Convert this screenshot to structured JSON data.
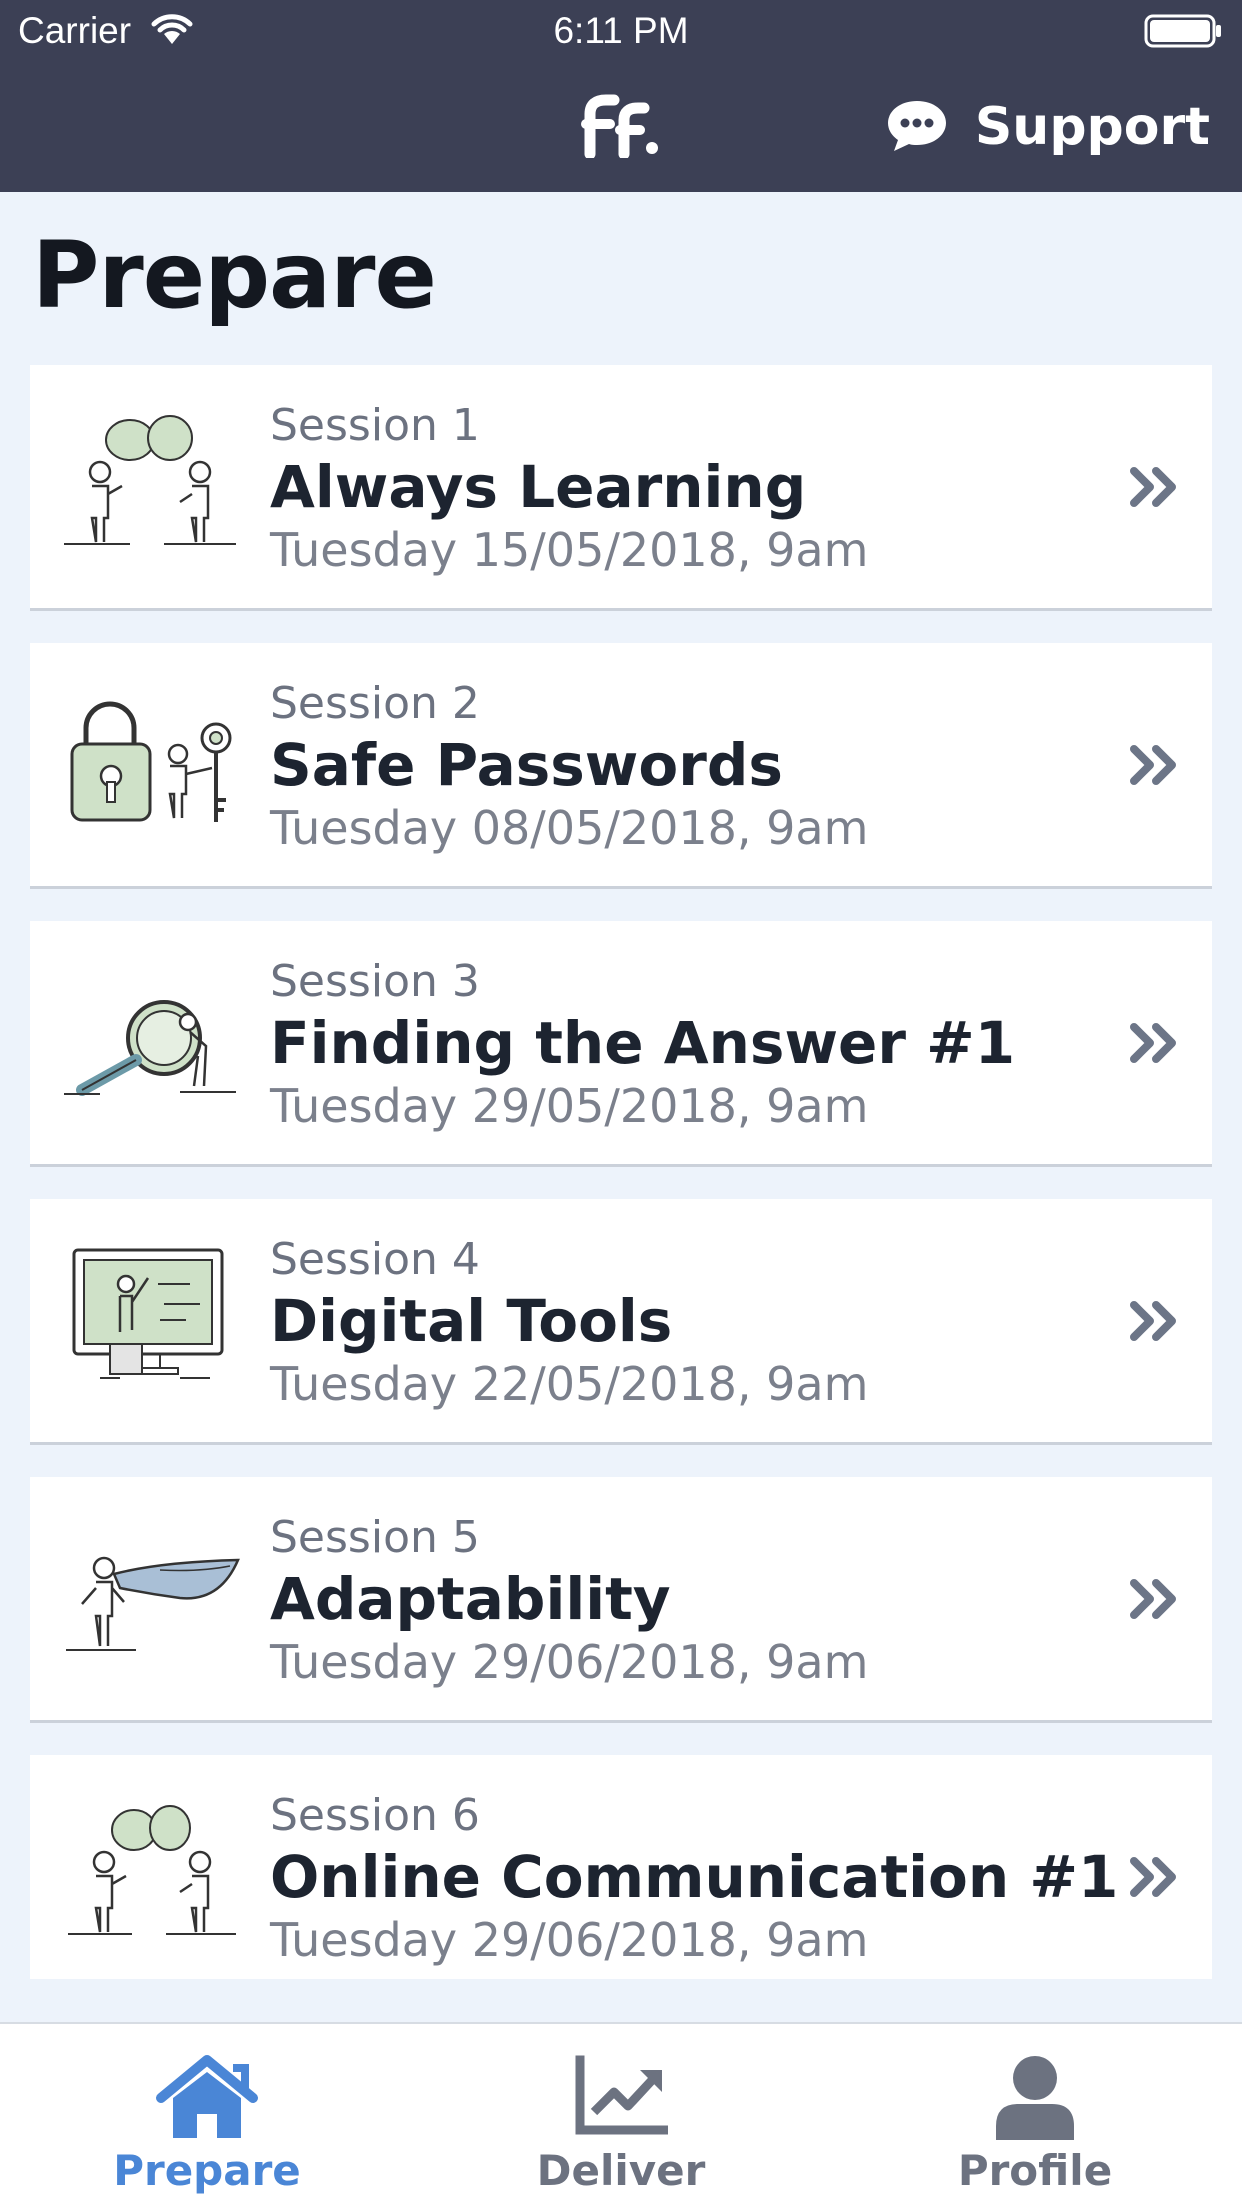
{
  "status_bar": {
    "carrier": "Carrier",
    "time": "6:11 PM"
  },
  "nav": {
    "logo_text": "Ff·",
    "support_label": "Support",
    "support_icon": "chat-bubble-icon"
  },
  "page": {
    "title": "Prepare"
  },
  "sessions": [
    {
      "number": "Session 1",
      "title": "Always Learning",
      "date": "Tuesday 15/05/2018, 9am",
      "illustration": "two-people-talking-illustration"
    },
    {
      "number": "Session 2",
      "title": "Safe Passwords",
      "date": "Tuesday 08/05/2018, 9am",
      "illustration": "padlock-and-key-illustration"
    },
    {
      "number": "Session 3",
      "title": "Finding the Answer #1",
      "date": "Tuesday 29/05/2018, 9am",
      "illustration": "magnifying-glass-illustration"
    },
    {
      "number": "Session 4",
      "title": "Digital Tools",
      "date": "Tuesday 22/05/2018, 9am",
      "illustration": "computer-screen-illustration"
    },
    {
      "number": "Session 5",
      "title": "Adaptability",
      "date": "Tuesday 29/06/2018, 9am",
      "illustration": "person-with-cape-illustration"
    },
    {
      "number": "Session 6",
      "title": "Online Communication #1",
      "date": "Tuesday 29/06/2018, 9am",
      "illustration": "two-people-talking-illustration"
    }
  ],
  "tabs": [
    {
      "label": "Prepare",
      "icon": "home-icon",
      "active": true
    },
    {
      "label": "Deliver",
      "icon": "chart-icon",
      "active": false
    },
    {
      "label": "Profile",
      "icon": "person-icon",
      "active": false
    }
  ],
  "colors": {
    "header_bg": "#3c4055",
    "page_bg": "#edf3fb",
    "accent": "#4a86d6",
    "chevron": "#6c7587",
    "illustration_green": "#cfe1c8"
  }
}
